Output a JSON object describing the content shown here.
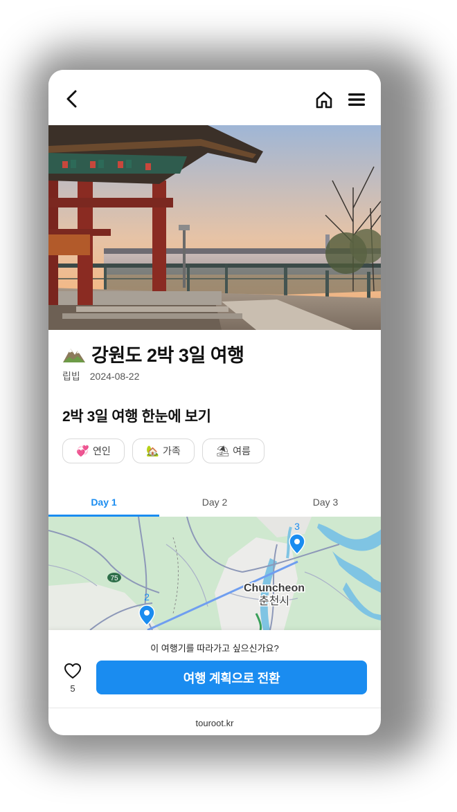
{
  "header": {
    "back_icon": "chevron-left-icon",
    "home_icon": "home-icon",
    "menu_icon": "hamburger-menu-icon"
  },
  "trip": {
    "title": "강원도 2박 3일 여행",
    "title_icon": "mountain-icon",
    "author": "립빕",
    "date": "2024-08-22"
  },
  "overview": {
    "title": "2박 3일 여행 한눈에 보기"
  },
  "tags": [
    {
      "emoji": "💞",
      "label": "연인"
    },
    {
      "emoji": "🏡",
      "label": "가족"
    },
    {
      "emoji": "⛱",
      "label": "여름"
    }
  ],
  "tabs": [
    {
      "label": "Day 1",
      "active": true
    },
    {
      "label": "Day 2",
      "active": false
    },
    {
      "label": "Day 3",
      "active": false
    }
  ],
  "map": {
    "city_en": "Chuncheon",
    "city_ko": "춘천시",
    "road_number": "75",
    "markers": [
      {
        "label": "2"
      },
      {
        "label": "3"
      }
    ]
  },
  "cta": {
    "question": "이 여행기를 따라가고 싶으신가요?",
    "button_label": "여행 계획으로 전환",
    "like_count": "5"
  },
  "footer": {
    "site": "touroot.kr"
  },
  "colors": {
    "accent": "#1a8cf0",
    "route": "#6f9ef0"
  }
}
